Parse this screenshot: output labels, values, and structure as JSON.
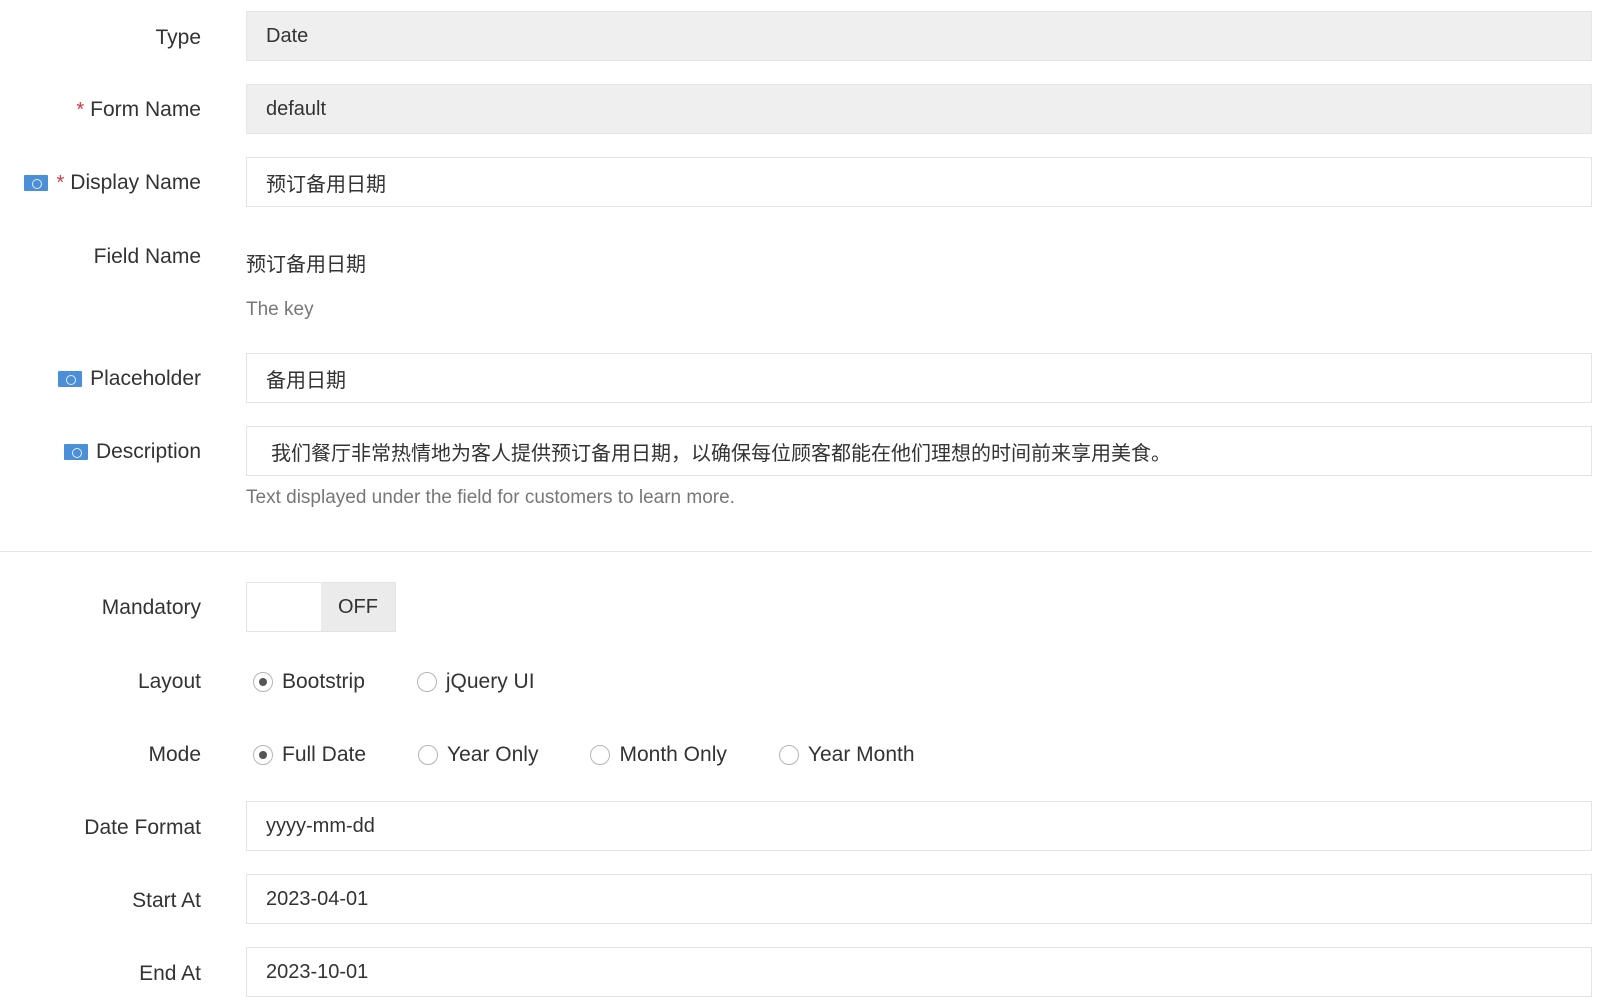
{
  "form": {
    "type": {
      "label": "Type",
      "value": "Date"
    },
    "form_name": {
      "label": "Form Name",
      "required_mark": "*",
      "value": "default"
    },
    "display_name": {
      "label": "Display Name",
      "required_mark": "*",
      "value": "预订备用日期",
      "icon": "language-flag-icon"
    },
    "field_name": {
      "label": "Field Name",
      "value": "预订备用日期",
      "help": "The key"
    },
    "placeholder": {
      "label": "Placeholder",
      "value": "备用日期",
      "icon": "language-flag-icon"
    },
    "description": {
      "label": "Description",
      "value": "我们餐厅非常热情地为客人提供预订备用日期，以确保每位顾客都能在他们理想的时间前来享用美食。",
      "help": "Text displayed under the field for customers to learn more.",
      "icon": "language-flag-icon"
    },
    "mandatory": {
      "label": "Mandatory",
      "state": "OFF"
    },
    "layout": {
      "label": "Layout",
      "options": [
        {
          "label": "Bootstrip",
          "selected": true
        },
        {
          "label": "jQuery UI",
          "selected": false
        }
      ]
    },
    "mode": {
      "label": "Mode",
      "options": [
        {
          "label": "Full Date",
          "selected": true
        },
        {
          "label": "Year Only",
          "selected": false
        },
        {
          "label": "Month Only",
          "selected": false
        },
        {
          "label": "Year Month",
          "selected": false
        }
      ]
    },
    "date_format": {
      "label": "Date Format",
      "value": "yyyy-mm-dd"
    },
    "start_at": {
      "label": "Start At",
      "value": "2023-04-01"
    },
    "end_at": {
      "label": "End At",
      "value": "2023-10-01"
    }
  },
  "colors": {
    "required": "#d9363e",
    "flag": "#4a8fd8",
    "readonly_bg": "#efefef",
    "help_text": "#777777"
  }
}
